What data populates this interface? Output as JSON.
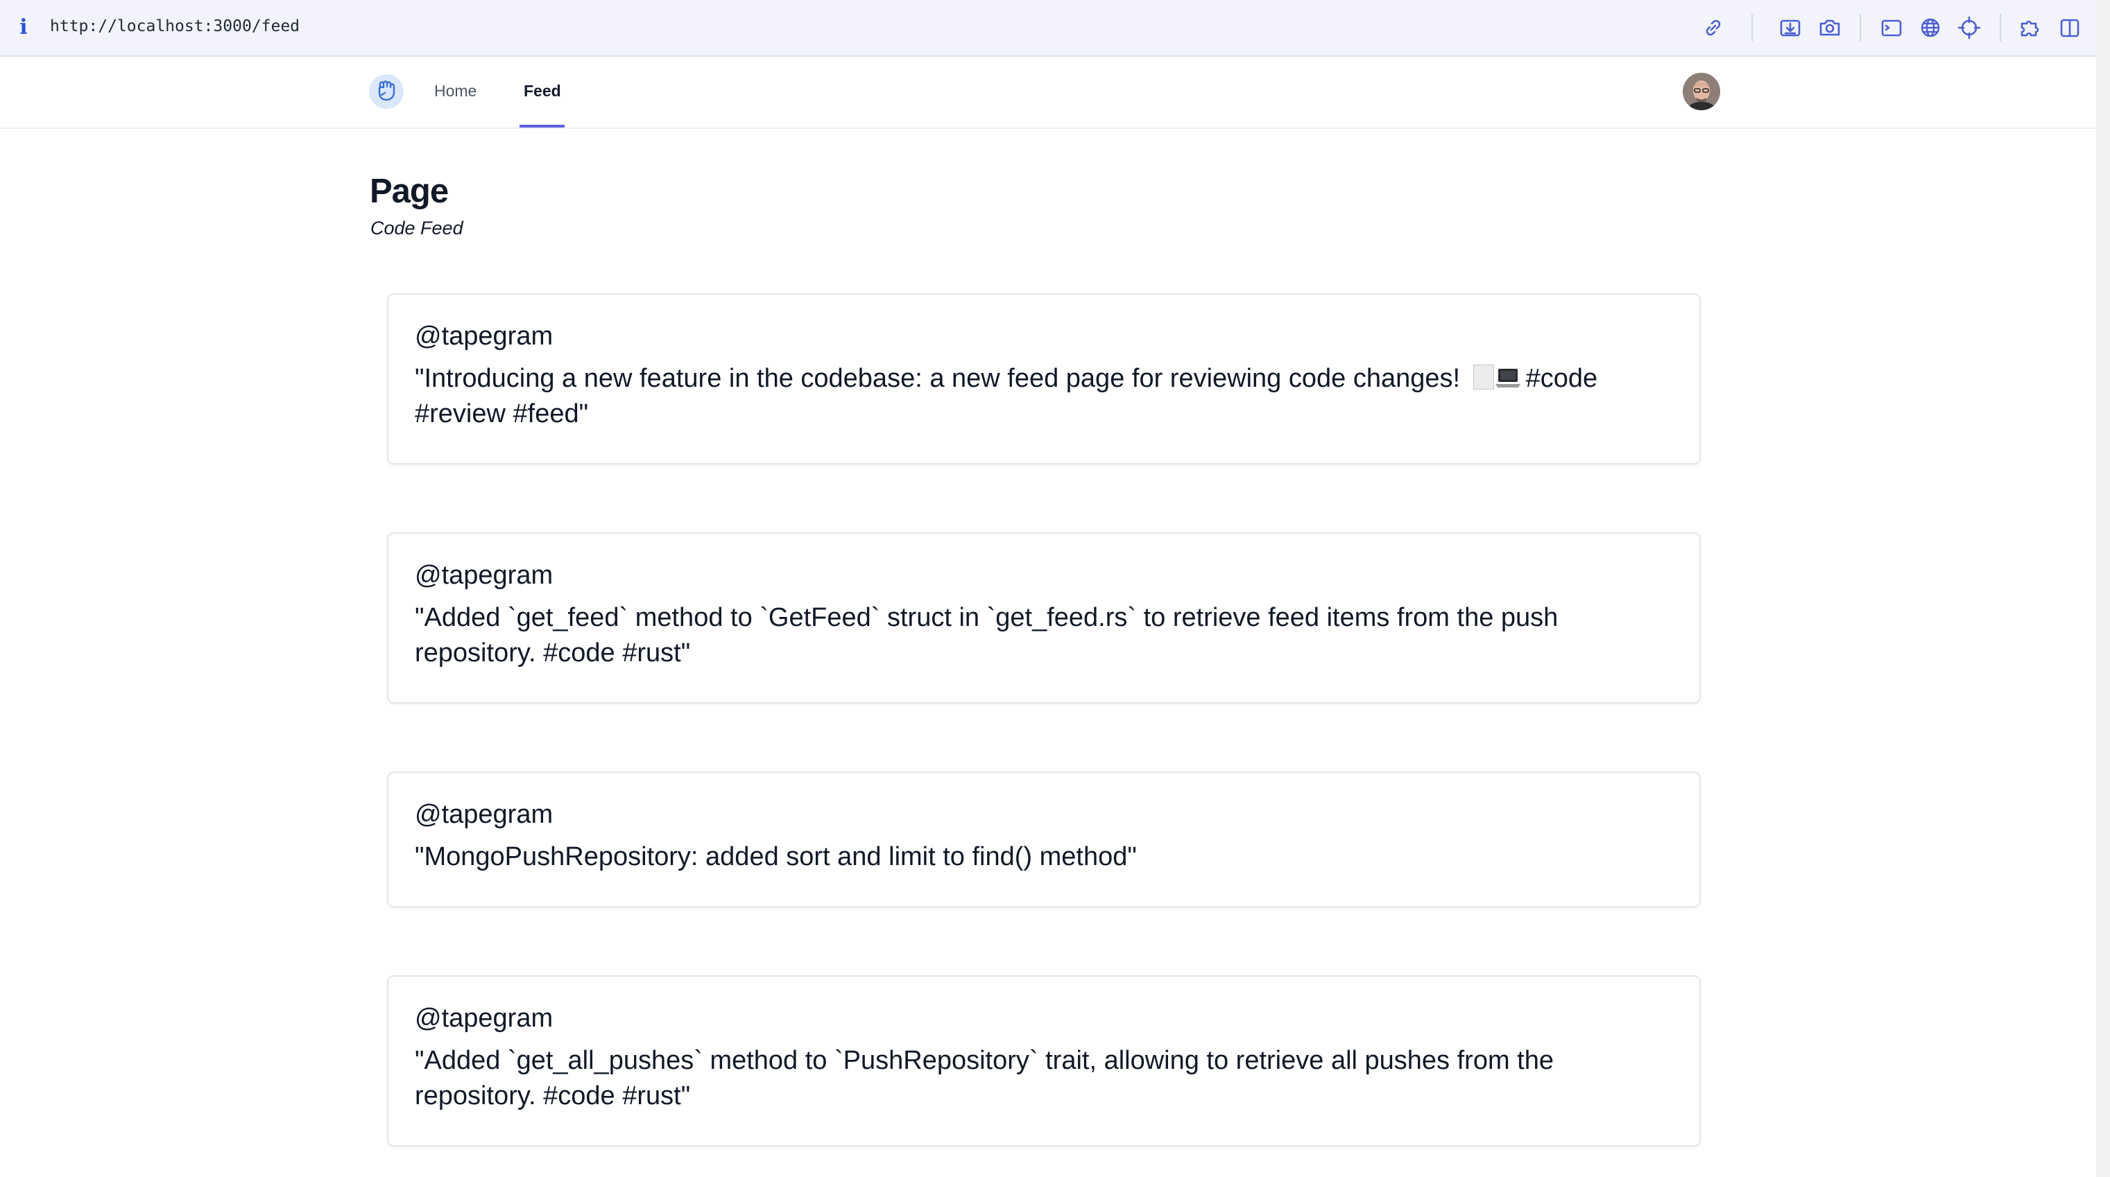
{
  "browser": {
    "url": "http://localhost:3000/feed",
    "info_icon": "i",
    "toolbar_icons": [
      "link-icon",
      "download-icon",
      "camera-icon",
      "terminal-icon",
      "globe-icon",
      "crosshair-icon",
      "puzzle-icon",
      "split-view-icon"
    ]
  },
  "nav": {
    "logo_icon": "fist-logo-icon",
    "links": [
      {
        "label": "Home",
        "active": false
      },
      {
        "label": "Feed",
        "active": true
      }
    ],
    "accent_color": "#5b5fe5"
  },
  "page": {
    "title": "Page",
    "subtitle": "Code Feed"
  },
  "feed": {
    "items": [
      {
        "author": "@tapegram",
        "text_before_emoji": "\"Introducing a new feature in the codebase: a new feed page for reviewing code changes! ",
        "emoji": [
          "page-emoji-icon",
          "laptop-emoji-icon"
        ],
        "text_after_emoji": "#code #review #feed\""
      },
      {
        "author": "@tapegram",
        "text": "\"Added `get_feed` method to `GetFeed` struct in `get_feed.rs` to retrieve feed items from the push repository. #code #rust\""
      },
      {
        "author": "@tapegram",
        "text": "\"MongoPushRepository: added sort and limit to find() method\""
      },
      {
        "author": "@tapegram",
        "text": "\"Added `get_all_pushes` method to `PushRepository` trait, allowing to retrieve all pushes from the repository. #code #rust\""
      }
    ]
  }
}
